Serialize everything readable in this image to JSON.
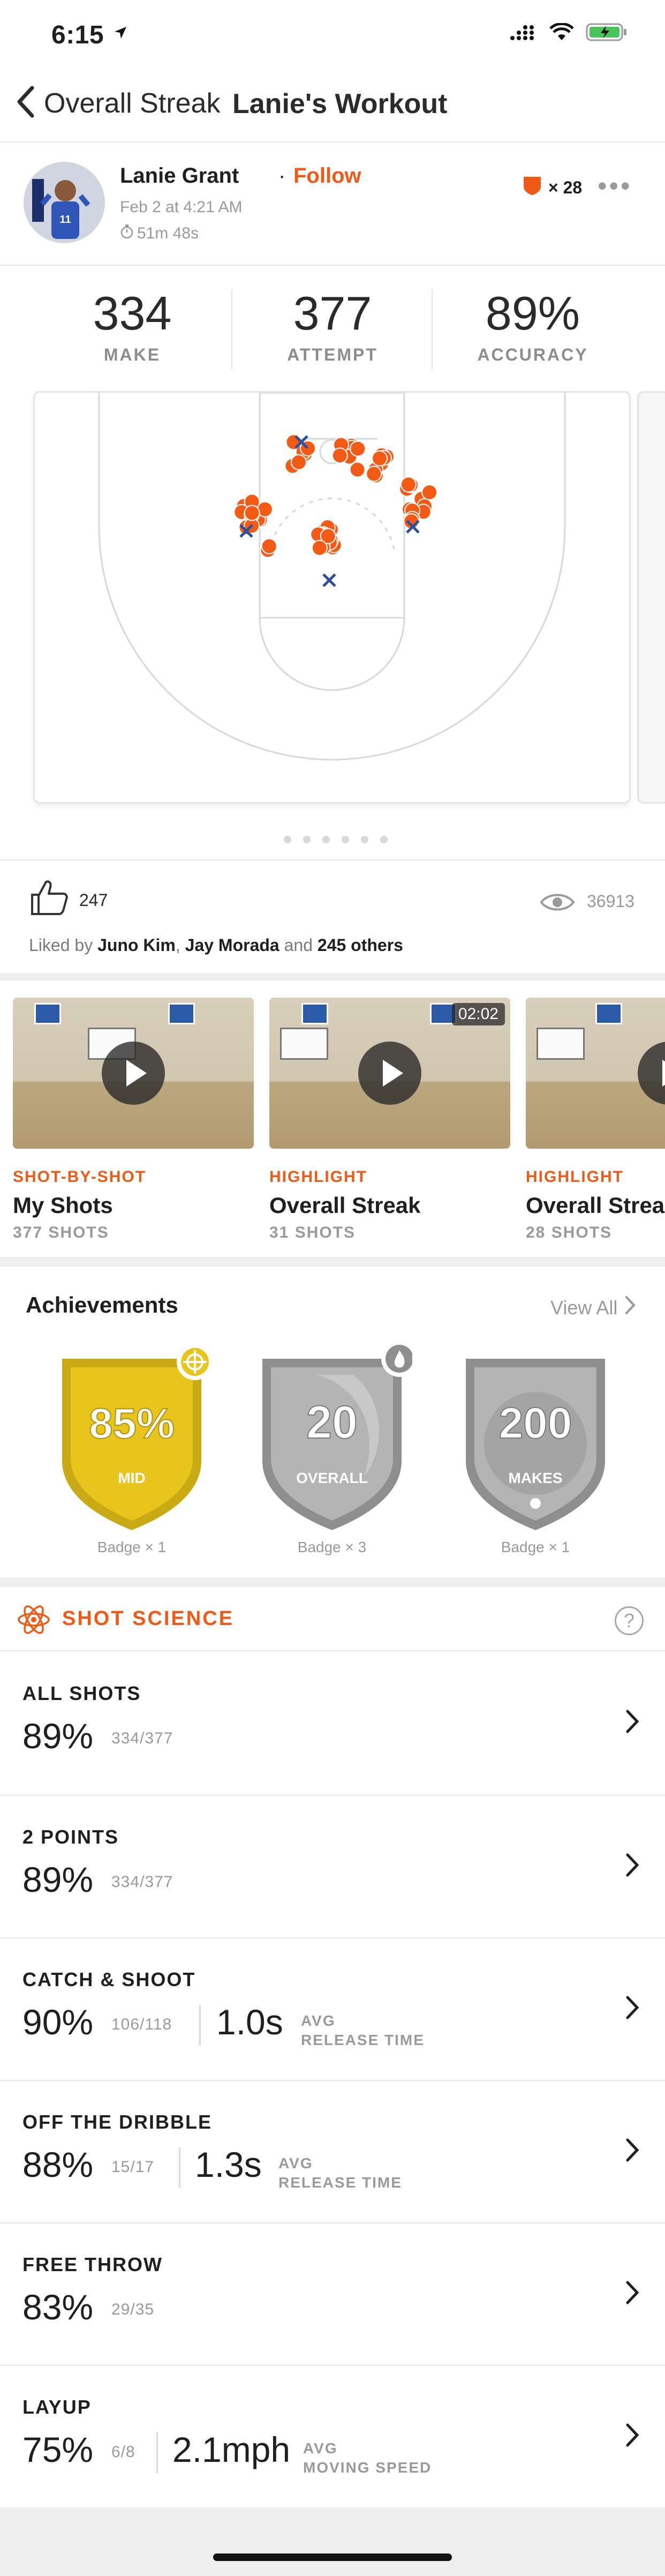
{
  "status_bar": {
    "time": "6:15"
  },
  "nav": {
    "back_label": "Overall Streak",
    "title": "Lanie's Workout"
  },
  "post": {
    "user_name": "Lanie Grant",
    "separator": "·",
    "follow_label": "Follow",
    "date": "Feb 2 at 4:21 AM",
    "duration": "51m 48s",
    "streak_count": "× 28",
    "more": "•••"
  },
  "stats": [
    {
      "value": "334",
      "label": "MAKE"
    },
    {
      "value": "377",
      "label": "ATTEMPT"
    },
    {
      "value": "89%",
      "label": "ACCURACY"
    }
  ],
  "shot_chart": {
    "colors": {
      "make": "#f25a16",
      "miss": "#2e4f9c",
      "court_line": "#d8d8d8"
    },
    "pages": 6,
    "active_page": 0
  },
  "social": {
    "likes": "247",
    "views": "36913",
    "liked_by_prefix": "Liked by",
    "liked_by_1": "Juno Kim",
    "liked_by_sep": ",",
    "liked_by_2": "Jay Morada",
    "liked_by_and": "and",
    "liked_by_others": "245 others"
  },
  "videos": [
    {
      "category": "SHOT-BY-SHOT",
      "title": "My Shots",
      "shots": "377 SHOTS",
      "duration": ""
    },
    {
      "category": "HIGHLIGHT",
      "title": "Overall Streak",
      "shots": "31 SHOTS",
      "duration": "02:02"
    },
    {
      "category": "HIGHLIGHT",
      "title": "Overall Streak",
      "shots": "28 SHOTS",
      "duration": ""
    }
  ],
  "achievements": {
    "title": "Achievements",
    "view_all": "View All",
    "badges": [
      {
        "value": "85%",
        "label": "MID",
        "caption": "Badge × 1",
        "color": "gold"
      },
      {
        "value": "20",
        "label": "OVERALL",
        "caption": "Badge × 3",
        "color": "silver"
      },
      {
        "value": "200",
        "label": "MAKES",
        "caption": "Badge × 1",
        "color": "silver"
      }
    ]
  },
  "shot_science": {
    "title": "SHOT SCIENCE",
    "help": "?",
    "rows": [
      {
        "label": "ALL SHOTS",
        "pct": "89%",
        "frac": "334/377"
      },
      {
        "label": "2 POINTS",
        "pct": "89%",
        "frac": "334/377"
      },
      {
        "label": "CATCH & SHOOT",
        "pct": "90%",
        "frac": "106/118",
        "metric": "1.0s",
        "metric_label_1": "AVG",
        "metric_label_2": "RELEASE TIME"
      },
      {
        "label": "OFF THE DRIBBLE",
        "pct": "88%",
        "frac": "15/17",
        "metric": "1.3s",
        "metric_label_1": "AVG",
        "metric_label_2": "RELEASE TIME"
      },
      {
        "label": "FREE THROW",
        "pct": "83%",
        "frac": "29/35"
      },
      {
        "label": "LAYUP",
        "pct": "75%",
        "frac": "6/8",
        "metric": "2.1mph",
        "metric_label_1": "AVG",
        "metric_label_2": "MOVING SPEED"
      }
    ]
  }
}
